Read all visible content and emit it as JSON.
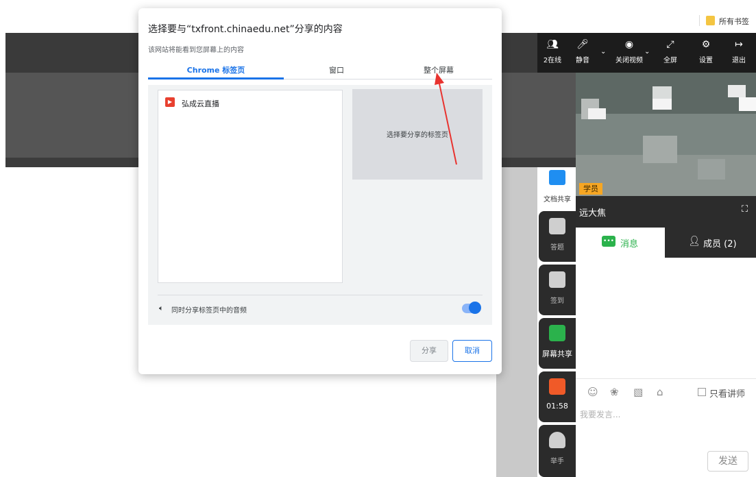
{
  "bookmarks": {
    "all_bookmarks": "所有书签"
  },
  "toolbar": {
    "online": "2在线",
    "mute": "静音",
    "close_video": "关闭视频",
    "fullscreen": "全屏",
    "settings": "设置",
    "exit": "退出"
  },
  "video": {
    "role_badge": "学员",
    "participant_name": "远大焦"
  },
  "tabs": {
    "messages": "消息",
    "members": "成员 (2)"
  },
  "side_tools": {
    "doc_share": "文档共享",
    "answer": "答题",
    "sign_in": "签到",
    "screen_share": "屏幕共享",
    "timer": "01:58",
    "raise_hand": "举手"
  },
  "chat": {
    "only_teacher": "只看讲师",
    "placeholder": "我要发言...",
    "send": "发送"
  },
  "dialog": {
    "title": "选择要与“txfront.chinaedu.net”分享的内容",
    "subtitle": "该网站将能看到您屏幕上的内容",
    "tabs": [
      "Chrome 标签页",
      "窗口",
      "整个屏幕"
    ],
    "tab_item": "弘成云直播",
    "preview_text": "选择要分享的标签页",
    "audio_label": "同时分享标签页中的音频",
    "share_button": "分享",
    "cancel_button": "取消"
  },
  "colors": {
    "accent_blue": "#1a73e8",
    "accent_green": "#2bb24c",
    "arrow_red": "#e8332f",
    "badge_orange": "#f6a623",
    "toolbar_dark": "#1c1c1c"
  }
}
